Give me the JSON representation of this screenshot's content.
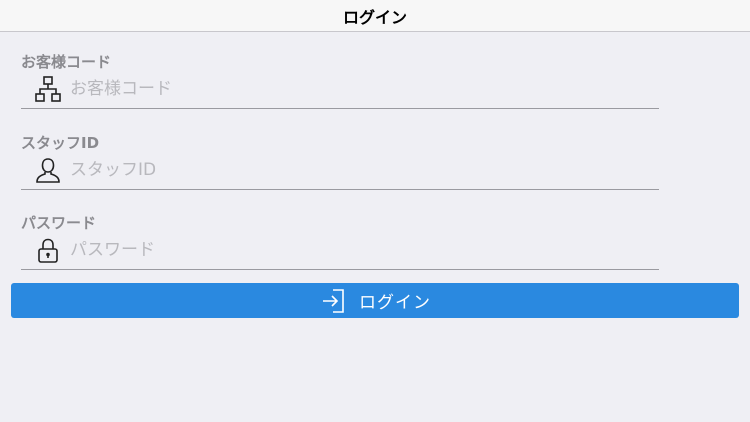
{
  "nav": {
    "title": "ログイン"
  },
  "form": {
    "customer_code": {
      "label": "お客様コード",
      "placeholder": "お客様コード",
      "value": "",
      "icon": "sitemap-icon"
    },
    "staff_id": {
      "label": "スタッフID",
      "placeholder": "スタッフID",
      "value": "",
      "icon": "user-icon"
    },
    "password": {
      "label": "パスワード",
      "placeholder": "パスワード",
      "value": "",
      "icon": "lock-icon"
    }
  },
  "login_button": {
    "label": "ログイン",
    "icon": "sign-in-icon"
  },
  "colors": {
    "background": "#efeff4",
    "accent": "#2a89e0",
    "label": "#8a8a8f",
    "placeholder": "#b8b8bd"
  }
}
